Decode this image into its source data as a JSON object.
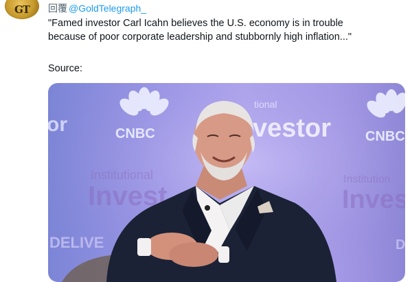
{
  "account": {
    "avatar_text": "GT",
    "avatar_icon": "gold-telegraph-logo"
  },
  "reply": {
    "label": "回覆",
    "handle": "@GoldTelegraph_"
  },
  "tweet": {
    "line1": "\"Famed investor Carl Icahn believes the U.S. economy is in trouble",
    "line2": "because of poor corporate leadership and stubbornly high inflation...\"",
    "source_label": "Source:"
  },
  "media": {
    "backdrop_texts": {
      "cnbc_left": "CNBC",
      "cnbc_right": "CNBC",
      "cnbc_partial": "or",
      "institutional_top": "tional",
      "investor_top": "vestor",
      "institutional_left": "Institutional",
      "investor_left": "Invest",
      "institutional_right": "Institution",
      "investor_right": "Invest",
      "delive": "DELIVE",
      "right_edge": "D"
    },
    "colors": {
      "backdrop": "#9a95e6",
      "suit": "#1b2236",
      "shirt": "#f4f2f2",
      "skin": "#d79a86",
      "hair": "#e8e4e2"
    }
  }
}
